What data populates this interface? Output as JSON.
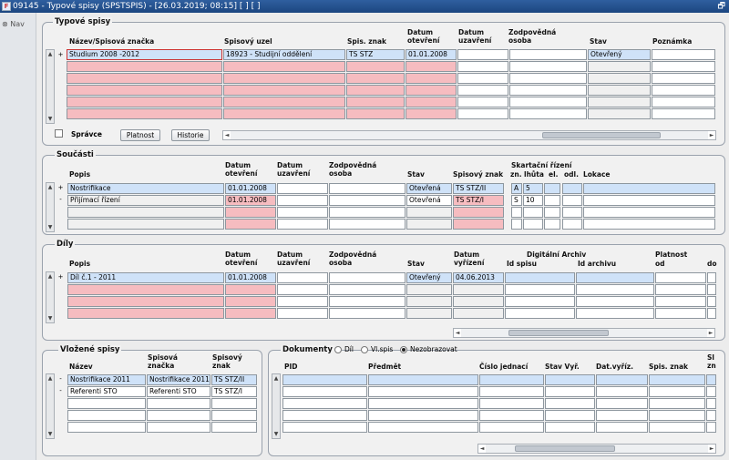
{
  "window": {
    "title": "09145 - Typové spisy (SPSTSPIS) - [26.03.2019; 08:15] [ ] [ ]",
    "restore": "🗗"
  },
  "nav": {
    "label": "Nav"
  },
  "typove": {
    "title": "Typové spisy",
    "headers": [
      "Název/Spisová značka",
      "Spisový uzel",
      "Spis. znak",
      "Datum otevření",
      "Datum uzavření",
      "Zodpovědná osoba",
      "Stav",
      "Poznámka"
    ],
    "row1": [
      "Studium 2008 -2012",
      "18923 - Studijní oddělení",
      "TS STZ",
      "01.01.2008",
      "",
      "",
      "Otevřený",
      ""
    ],
    "spravce": "Správce",
    "platnost": "Platnost",
    "historie": "Historie"
  },
  "soucasti": {
    "title": "Součásti",
    "headers": [
      "Popis",
      "Datum otevření",
      "Datum uzavření",
      "Zodpovědná osoba",
      "Stav",
      "Spisový znak",
      "Skartační řízení",
      "zn.",
      "lhůta",
      "el.",
      "odl.",
      "Lokace"
    ],
    "rows": [
      [
        "+",
        "Nostrifikace",
        "01.01.2008",
        "",
        "",
        "Otevřená",
        "TS STZ/II",
        "A",
        "5"
      ],
      [
        "-",
        "Přijímací řízení",
        "01.01.2008",
        "",
        "",
        "Otevřená",
        "TS STZ/I",
        "S",
        "10"
      ]
    ]
  },
  "dily": {
    "title": "Díly",
    "headers": [
      "Popis",
      "Datum otevření",
      "Datum uzavření",
      "Zodpovědná osoba",
      "Stav",
      "Datum vyřízení",
      "Digitální Archiv",
      "Id spisu",
      "Id archivu",
      "Platnost",
      "od",
      "do"
    ],
    "row1": [
      "+",
      "Díl č.1 - 2011",
      "01.01.2008",
      "",
      "",
      "Otevřený",
      "04.06.2013"
    ]
  },
  "vlozene": {
    "title": "Vložené spisy",
    "headers": [
      "Název",
      "Spisová značka",
      "Spisový znak"
    ],
    "rows": [
      [
        "Nostrifikace 2011",
        "Nostrifikace 2011",
        "TS STZ/II"
      ],
      [
        "Referenti STO",
        "Referenti STO",
        "TS STZ/I"
      ]
    ]
  },
  "dokumenty": {
    "title": "Dokumenty",
    "radios": [
      "Díl",
      "Vl.spis",
      "Nezobrazovat"
    ],
    "headers": [
      "PID",
      "Předmět",
      "Číslo jednací",
      "Stav Vyř.",
      "Dat.vyříz.",
      "Spis. znak",
      "Sl zn"
    ]
  }
}
